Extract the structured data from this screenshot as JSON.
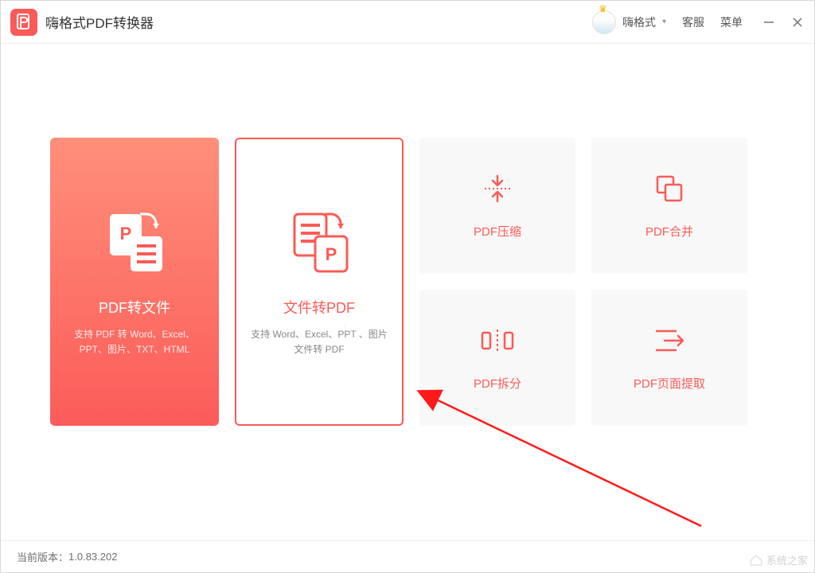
{
  "app": {
    "title": "嗨格式PDF转换器"
  },
  "titlebar": {
    "username": "嗨格式",
    "support": "客服",
    "menu": "菜单"
  },
  "cards": {
    "pdf_to_file": {
      "title": "PDF转文件",
      "desc": "支持 PDF 转 Word、Excel、PPT、图片、TXT、HTML"
    },
    "file_to_pdf": {
      "title": "文件转PDF",
      "desc": "支持 Word、Excel、PPT 、图片文件转 PDF"
    },
    "compress": {
      "label": "PDF压缩"
    },
    "merge": {
      "label": "PDF合并"
    },
    "split": {
      "label": "PDF拆分"
    },
    "extract": {
      "label": "PDF页面提取"
    }
  },
  "status": {
    "version_label": "当前版本：",
    "version": "1.0.83.202"
  },
  "watermark": {
    "text": "系统之家"
  }
}
